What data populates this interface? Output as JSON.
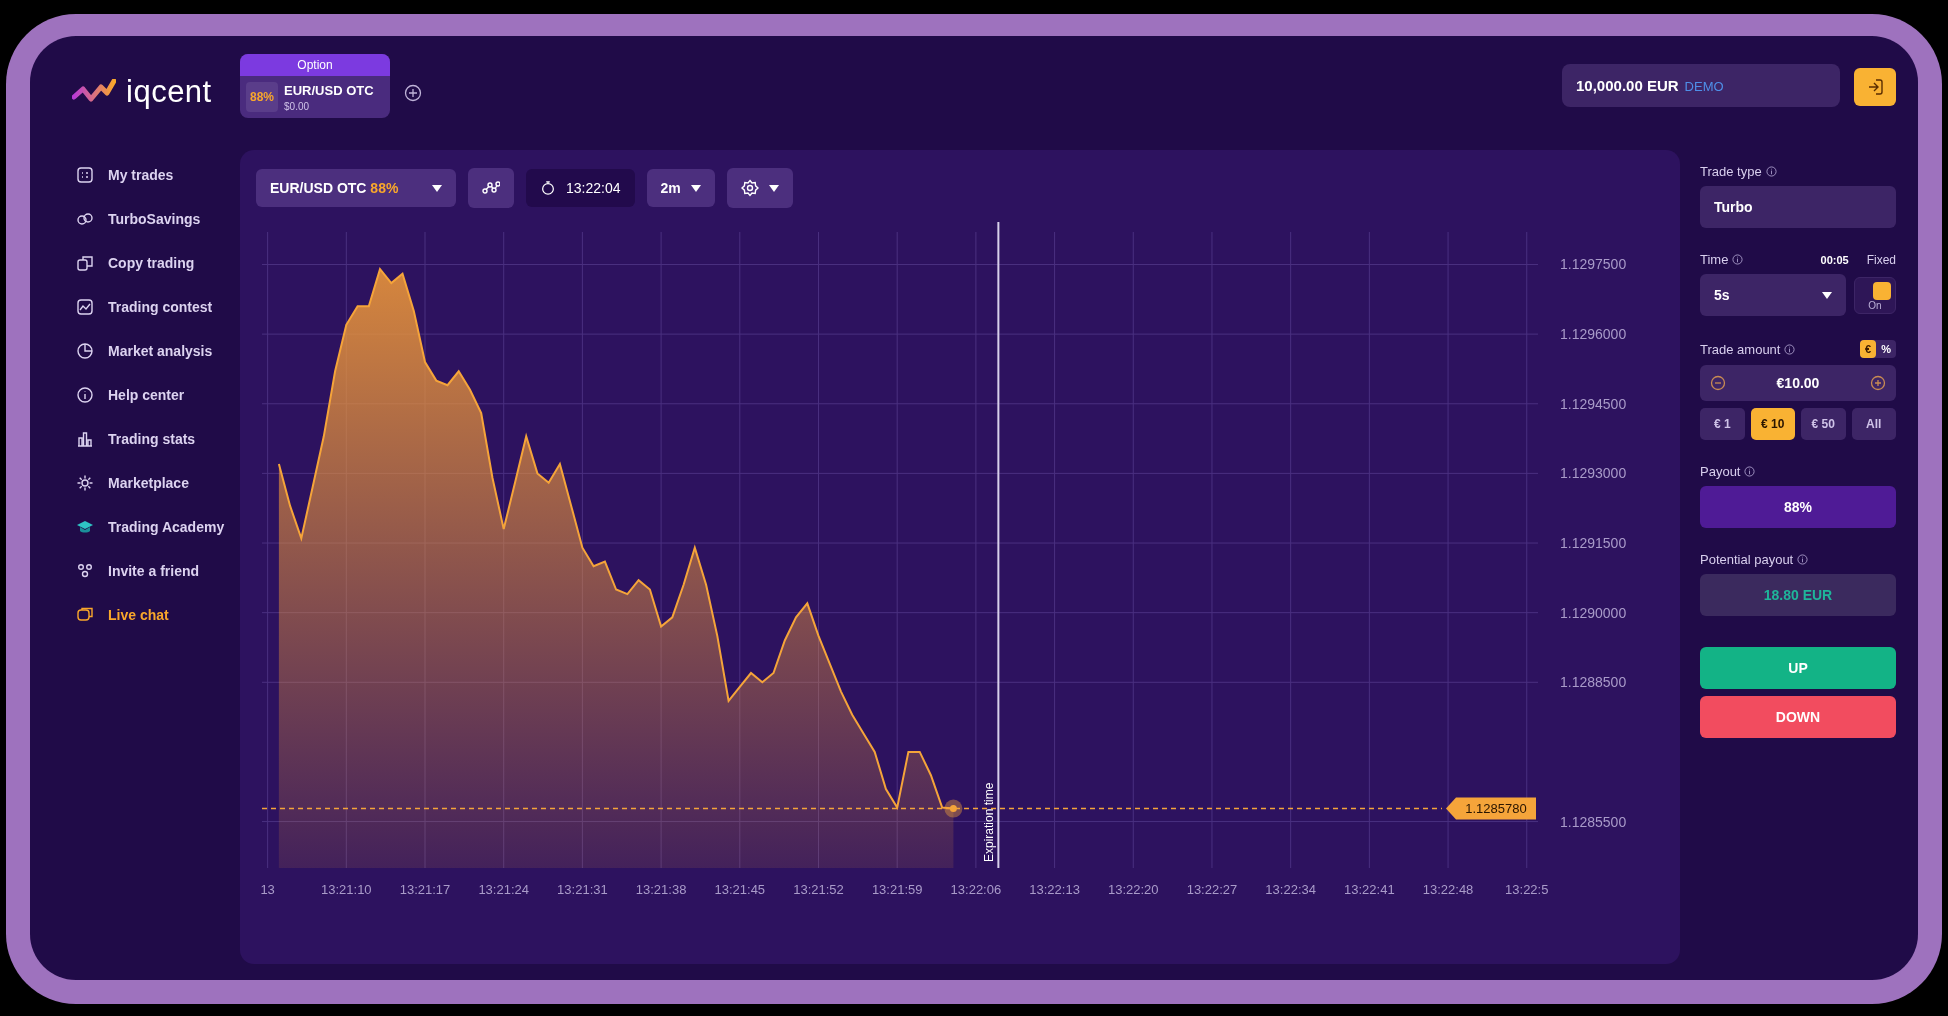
{
  "logo": {
    "text": "iqcent"
  },
  "asset_tabs": [
    {
      "badge": "Option",
      "payout": "88%",
      "name": "EUR/USD OTC",
      "amount": "$0.00",
      "selected": true
    }
  ],
  "balance": {
    "amount": "10,000.00 EUR",
    "mode": "DEMO"
  },
  "sidebar": {
    "items": [
      {
        "label": "My trades",
        "selected": false
      },
      {
        "label": "TurboSavings",
        "selected": false
      },
      {
        "label": "Copy trading",
        "selected": false
      },
      {
        "label": "Trading contest",
        "selected": false
      },
      {
        "label": "Market analysis",
        "selected": false
      },
      {
        "label": "Help center",
        "selected": false
      },
      {
        "label": "Trading stats",
        "selected": false
      },
      {
        "label": "Marketplace",
        "selected": false
      },
      {
        "label": "Trading Academy",
        "selected": false
      },
      {
        "label": "Invite a friend",
        "selected": false
      },
      {
        "label": "Live chat",
        "selected": true
      }
    ]
  },
  "toolbar": {
    "asset": "EUR/USD OTC",
    "payout": "88%",
    "clock": "13:22:04",
    "timeframe": "2m"
  },
  "chart": {
    "chart_data": {
      "type": "area",
      "categories": [
        "13",
        null,
        null,
        null,
        null,
        null,
        null,
        "13:21:10",
        null,
        null,
        null,
        null,
        null,
        null,
        "13:21:17",
        null,
        null,
        null,
        null,
        null,
        null,
        "13:21:24",
        null,
        null,
        null,
        null,
        null,
        null,
        "13:21:31",
        null,
        null,
        null,
        null,
        null,
        null,
        "13:21:38",
        null,
        null,
        null,
        null,
        null,
        null,
        "13:21:45",
        null,
        null,
        null,
        null,
        null,
        null,
        "13:21:52",
        null,
        null,
        null,
        null,
        null,
        null,
        "13:21:59",
        null,
        null,
        null,
        null,
        null,
        null,
        "13:22:06",
        null,
        null,
        null,
        null,
        null,
        null,
        "13:22:13",
        null,
        null,
        null,
        null,
        null,
        null,
        "13:22:20",
        null,
        null,
        null,
        null,
        null,
        null,
        "13:22:27",
        null,
        null,
        null,
        null,
        null,
        null,
        "13:22:34",
        null,
        null,
        null,
        null,
        null,
        null,
        "13:22:41",
        null,
        null,
        null,
        null,
        null,
        null,
        "13:22:48",
        null,
        null,
        null,
        null,
        null,
        null,
        "13:22:5"
      ],
      "series": [
        {
          "color": "#f5a43a",
          "values": [
            null,
            1.12932,
            1.12923,
            1.12916,
            1.12927,
            1.12938,
            1.12952,
            1.12962,
            1.12966,
            1.12966,
            1.12974,
            1.12971,
            1.12973,
            1.12965,
            1.12954,
            1.1295,
            1.12949,
            1.12952,
            1.12948,
            1.12943,
            1.12929,
            1.12918,
            1.12928,
            1.12938,
            1.1293,
            1.12928,
            1.12932,
            1.12923,
            1.12914,
            1.1291,
            1.12911,
            1.12905,
            1.12904,
            1.12907,
            1.12905,
            1.12897,
            1.12899,
            1.12906,
            1.12914,
            1.12906,
            1.12895,
            1.12881,
            1.12884,
            1.12887,
            1.12885,
            1.12887,
            1.12894,
            1.12899,
            1.12902,
            1.12895,
            1.12889,
            1.12883,
            1.12878,
            1.12874,
            1.1287,
            1.12862,
            1.12858,
            1.1287,
            1.1287,
            1.12865,
            1.12858,
            1.128578,
            null,
            null,
            null,
            null,
            null,
            null,
            null,
            null,
            null,
            null,
            null,
            null,
            null,
            null,
            null,
            null,
            null,
            null,
            null,
            null,
            null,
            null,
            null,
            null,
            null,
            null,
            null,
            null,
            null,
            null,
            null,
            null,
            null,
            null,
            null,
            null,
            null,
            null,
            null,
            null,
            null,
            null,
            null,
            null,
            null,
            null,
            null,
            null,
            null,
            null,
            null
          ]
        }
      ],
      "ylim": [
        1.12845,
        1.12982
      ],
      "yticks": [
        {
          "value": 1.12975,
          "label": "1.1297500"
        },
        {
          "value": 1.1296,
          "label": "1.1296000"
        },
        {
          "value": 1.12945,
          "label": "1.1294500"
        },
        {
          "value": 1.1293,
          "label": "1.1293000"
        },
        {
          "value": 1.12915,
          "label": "1.1291500"
        },
        {
          "value": 1.129,
          "label": "1.1290000"
        },
        {
          "value": 1.12885,
          "label": "1.1288500"
        },
        {
          "value": 1.12855,
          "label": "1.1285500"
        }
      ],
      "grid": true,
      "ref_lines": [
        {
          "axis": "y",
          "value": 1.128578,
          "label": "1.1285780",
          "color": "#f5a43a"
        }
      ],
      "annotations": [
        "Expiration time"
      ]
    }
  },
  "trade_panel": {
    "trade_type_label": "Trade type",
    "trade_type": "Turbo",
    "time_label": "Time",
    "time_remaining": "00:05",
    "fixed_label": "Fixed",
    "time_value": "5s",
    "fixed": {
      "on": true,
      "label": "On"
    },
    "amount_label": "Trade amount",
    "currency_modes": [
      {
        "label": "€",
        "selected": true
      },
      {
        "label": "%",
        "selected": false
      }
    ],
    "amount": "€10.00",
    "presets": [
      {
        "label": "€ 1",
        "selected": false
      },
      {
        "label": "€ 10",
        "selected": true
      },
      {
        "label": "€ 50",
        "selected": false
      },
      {
        "label": "All",
        "selected": false
      }
    ],
    "payout_label": "Payout",
    "payout": "88%",
    "potential_label": "Potential payout",
    "potential": "18.80 EUR",
    "buttons": [
      {
        "label": "UP",
        "kind": "up"
      },
      {
        "label": "DOWN",
        "kind": "down"
      }
    ]
  }
}
